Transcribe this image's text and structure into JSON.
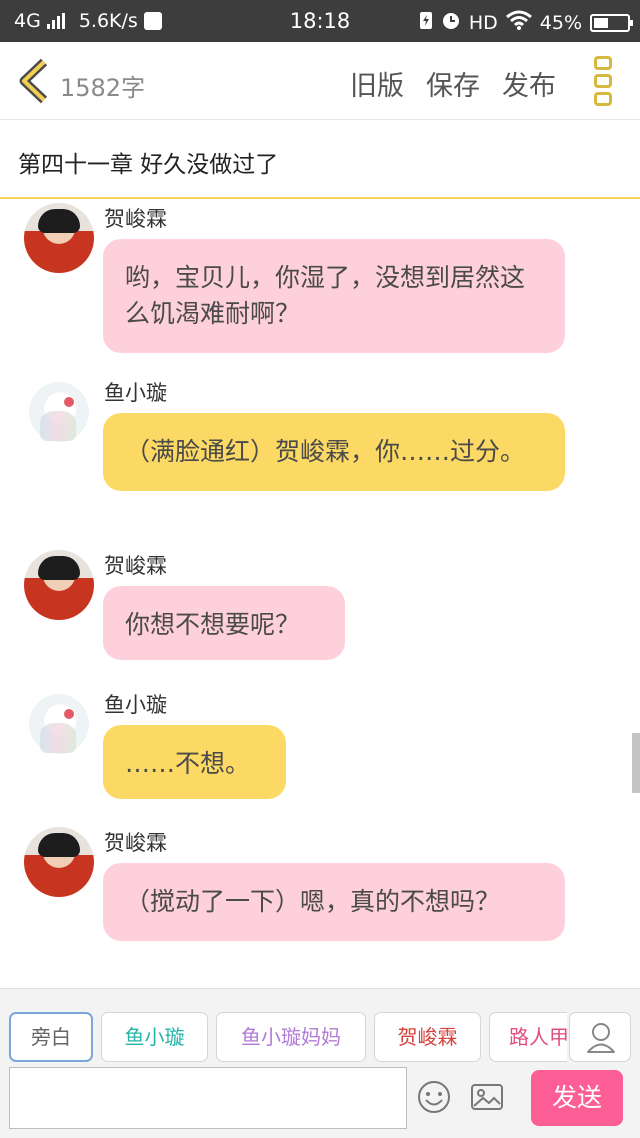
{
  "status_bar": {
    "network": "4G",
    "speed": "5.6K/s",
    "time": "18:18",
    "hd": "HD",
    "battery": "45%",
    "battery_level": 0.45
  },
  "toolbar": {
    "word_count": "1582字",
    "old_version": "旧版",
    "save": "保存",
    "publish": "发布"
  },
  "chapter": {
    "title": "第四十一章 好久没做过了"
  },
  "messages": [
    {
      "speaker": "贺峻霖",
      "text": "哟，宝贝儿，你湿了，没想到居然这么饥渴难耐啊？",
      "color": "pink"
    },
    {
      "speaker": "鱼小璇",
      "text": "（满脸通红）贺峻霖，你……过分。",
      "color": "yellow"
    },
    {
      "speaker": "贺峻霖",
      "text": "你想不想要呢？",
      "color": "pink"
    },
    {
      "speaker": "鱼小璇",
      "text": "……不想。",
      "color": "yellow"
    },
    {
      "speaker": "贺峻霖",
      "text": "（搅动了一下）嗯，真的不想吗？",
      "color": "pink"
    }
  ],
  "characters": [
    {
      "label": "旁白",
      "color": "#666666"
    },
    {
      "label": "鱼小璇",
      "color": "#26b5a9"
    },
    {
      "label": "鱼小璇妈妈",
      "color": "#b27bd6"
    },
    {
      "label": "贺峻霖",
      "color": "#d6413b"
    },
    {
      "label": "路人甲",
      "color": "#e0507e"
    }
  ],
  "composer": {
    "input_value": "",
    "send": "发送"
  },
  "colors": {
    "pink_bubble": "#fdd0dc",
    "yellow_bubble": "#fbd964",
    "send_button": "#fe5e96",
    "accent": "#d6b83f"
  },
  "icons": {
    "back": "chevron-left-icon",
    "menu": "more-vertical-icon",
    "emoji": "emoji-icon",
    "image": "image-icon",
    "role": "user-icon"
  }
}
